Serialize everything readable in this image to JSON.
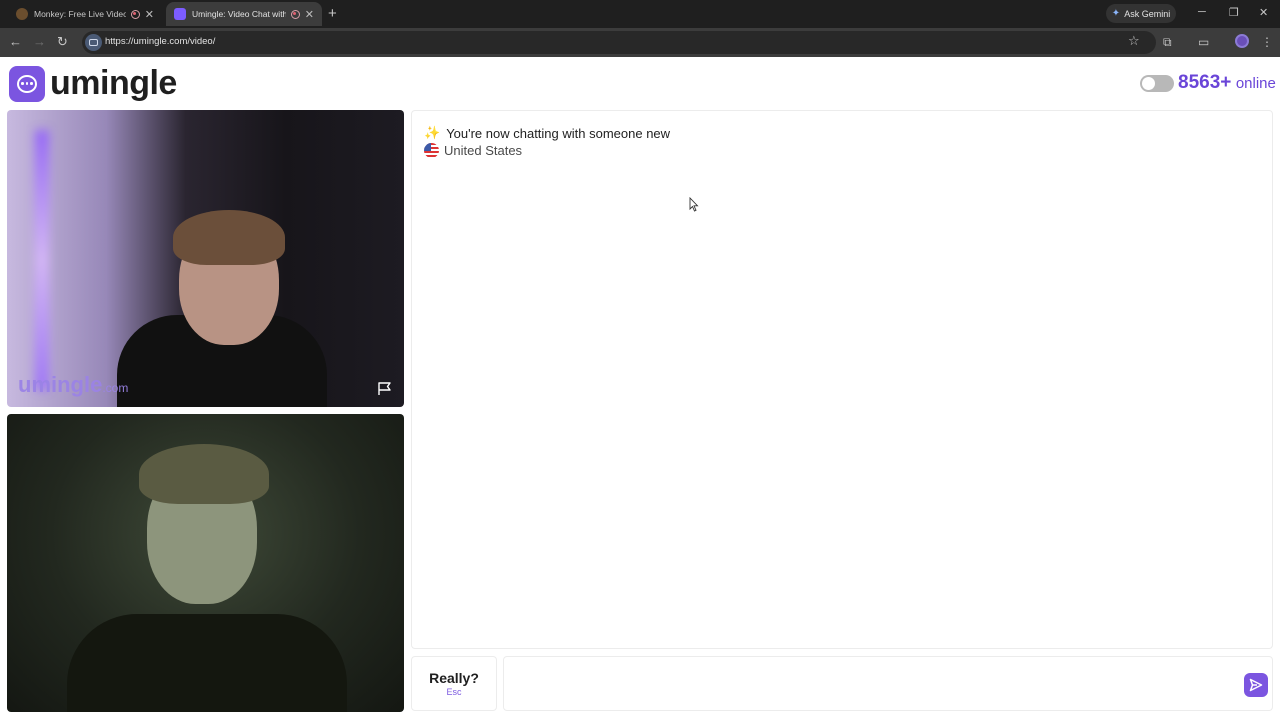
{
  "browser": {
    "tabs": [
      {
        "title": "Monkey: Free Live Video Ch",
        "active": false
      },
      {
        "title": "Umingle: Video Chat with S",
        "active": true
      }
    ],
    "ask_gemini": "Ask Gemini",
    "url": "https://umingle.com/video/"
  },
  "header": {
    "logo_text": "umingle",
    "online_count": "8563+",
    "online_label": "online"
  },
  "video": {
    "watermark_main": "umingle",
    "watermark_suffix": ".com"
  },
  "chat": {
    "system_message": "You're now chatting with someone new",
    "country": "United States"
  },
  "controls": {
    "skip_label": "Really?",
    "skip_hint": "Esc",
    "message_placeholder": ""
  },
  "colors": {
    "accent": "#7b55e0",
    "online_text": "#6a45d8"
  }
}
